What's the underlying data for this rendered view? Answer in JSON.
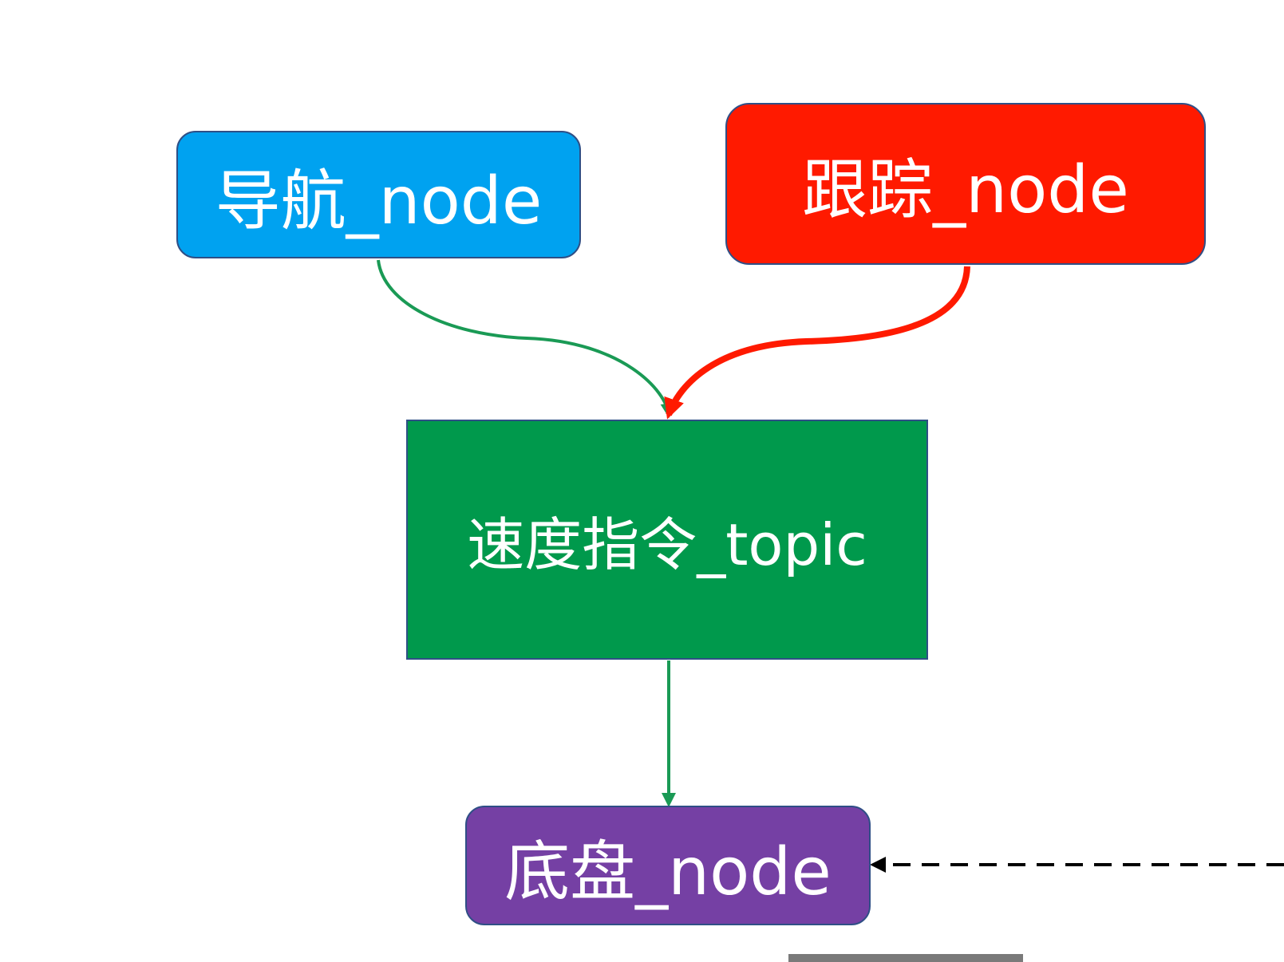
{
  "diagram": {
    "nodes": {
      "navigation": {
        "label": "导航_node",
        "color": "#00a2f0"
      },
      "tracking": {
        "label": "跟踪_node",
        "color": "#ff1a00"
      },
      "velocity_topic": {
        "label": "速度指令_topic",
        "color": "#00994c"
      },
      "chassis": {
        "label": "底盘_node",
        "color": "#7540a4"
      }
    },
    "edges": [
      {
        "from": "navigation",
        "to": "velocity_topic",
        "color": "#1a9a55",
        "style": "solid"
      },
      {
        "from": "tracking",
        "to": "velocity_topic",
        "color": "#ff1a00",
        "style": "solid"
      },
      {
        "from": "velocity_topic",
        "to": "chassis",
        "color": "#1a9a55",
        "style": "solid"
      },
      {
        "from": "offscreen-right",
        "to": "chassis",
        "color": "#000000",
        "style": "dashed"
      }
    ]
  }
}
